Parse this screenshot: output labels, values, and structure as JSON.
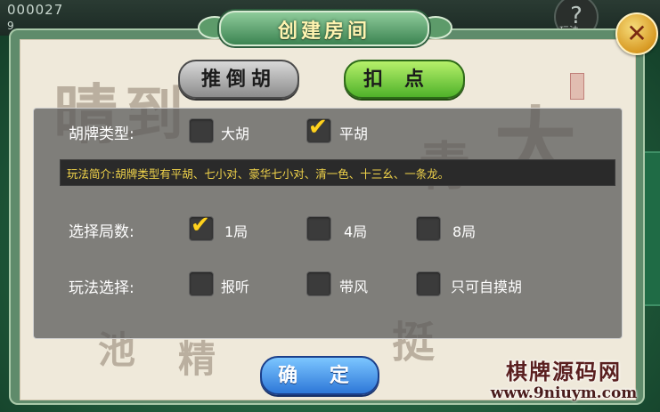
{
  "background": {
    "room_id": "000027",
    "small_text": "9",
    "help_glyph": "?",
    "help_label": "玩法"
  },
  "dialog": {
    "title": "创建房间",
    "close_glyph": "✕",
    "mode_tabs": [
      {
        "label": "推倒胡",
        "selected": false
      },
      {
        "label": "扣点",
        "selected": true
      }
    ],
    "rows": {
      "hu_type": {
        "label": "胡牌类型:",
        "options": [
          {
            "label": "大胡",
            "checked": false
          },
          {
            "label": "平胡",
            "checked": true
          }
        ]
      },
      "rounds": {
        "label": "选择局数:",
        "options": [
          {
            "label": "1局",
            "checked": true
          },
          {
            "label": "4局",
            "checked": false
          },
          {
            "label": "8局",
            "checked": false
          }
        ]
      },
      "play": {
        "label": "玩法选择:",
        "options": [
          {
            "label": "报听",
            "checked": false
          },
          {
            "label": "带风",
            "checked": false
          },
          {
            "label": "只可自摸胡",
            "checked": false
          }
        ]
      }
    },
    "info_text": "玩法简介:胡牌类型有平胡、七小对、豪华七小对、清一色、十三幺、一条龙。",
    "confirm_label": "确 定",
    "check_glyph": "✔"
  },
  "watermark": {
    "title": "棋牌源码网",
    "url": "www.9niuym.com"
  },
  "colors": {
    "check": "#ffd21e",
    "info_text": "#f0d34a",
    "tab_selected": "#4fb22a",
    "confirm": "#2d77d8"
  }
}
